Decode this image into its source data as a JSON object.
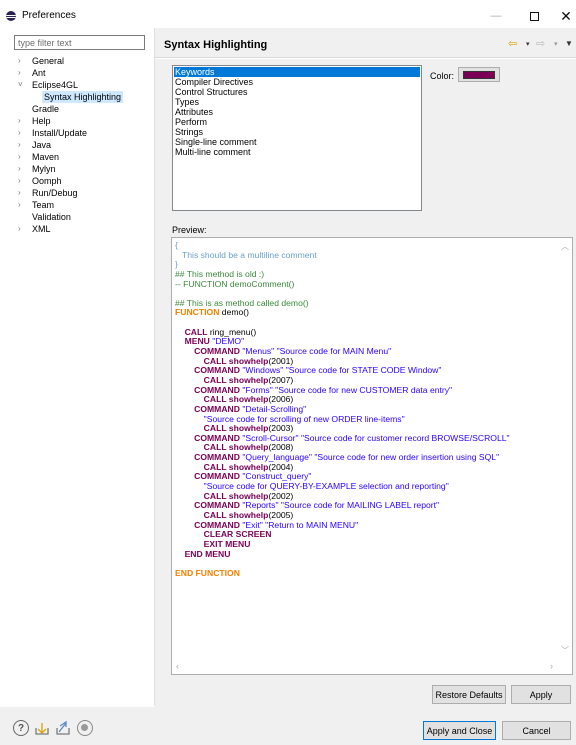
{
  "window": {
    "title": "Preferences",
    "min": "—",
    "close": "✕"
  },
  "filter": {
    "placeholder": "type filter text",
    "value": ""
  },
  "tree": {
    "items": [
      {
        "label": "General",
        "arrow": "›"
      },
      {
        "label": "Ant",
        "arrow": "›"
      },
      {
        "label": "Eclipse4GL",
        "arrow": "˅"
      },
      {
        "label": "Syntax Highlighting",
        "arrow": "",
        "selected": true
      },
      {
        "label": "Gradle",
        "arrow": ""
      },
      {
        "label": "Help",
        "arrow": "›"
      },
      {
        "label": "Install/Update",
        "arrow": "›"
      },
      {
        "label": "Java",
        "arrow": "›"
      },
      {
        "label": "Maven",
        "arrow": "›"
      },
      {
        "label": "Mylyn",
        "arrow": "›"
      },
      {
        "label": "Oomph",
        "arrow": "›"
      },
      {
        "label": "Run/Debug",
        "arrow": "›"
      },
      {
        "label": "Team",
        "arrow": "›"
      },
      {
        "label": "Validation",
        "arrow": ""
      },
      {
        "label": "XML",
        "arrow": "›"
      }
    ]
  },
  "page": {
    "title": "Syntax Highlighting",
    "nav": {
      "back": "⇦",
      "forward": "⇨",
      "dropdown": "▾",
      "menu": "▼"
    }
  },
  "elements": {
    "items": [
      "Keywords",
      "Compiler Directives",
      "Control Structures",
      "Types",
      "Attributes",
      "Perform",
      "Strings",
      "Single-line comment",
      "Multi-line comment"
    ],
    "selected_index": 0,
    "color_label": "Color:",
    "color_value": "#7a0055"
  },
  "preview": {
    "label": "Preview:",
    "colors": {
      "multiline_comment": "#6aa0c8",
      "singleline_comment": "#3a8a3a",
      "function_kw": "#f08000",
      "keyword": "#7a0055",
      "string": "#2a00ff"
    },
    "lines": [
      [
        [
          "mc",
          "{"
        ]
      ],
      [
        [
          "mc",
          "   This should be a multiline comment"
        ]
      ],
      [
        [
          "mc",
          "}"
        ]
      ],
      [
        [
          "sc",
          "## This method is old :)"
        ]
      ],
      [
        [
          "sc",
          "-- FUNCTION demoComment()"
        ]
      ],
      [],
      [
        [
          "sc",
          "## This is as method called demo()"
        ]
      ],
      [
        [
          "fn",
          "FUNCTION"
        ],
        [
          "pl",
          " demo()"
        ]
      ],
      [],
      [
        [
          "pl",
          "    "
        ],
        [
          "kw",
          "CALL"
        ],
        [
          "pl",
          " ring_menu()"
        ]
      ],
      [
        [
          "pl",
          "    "
        ],
        [
          "kw",
          "MENU"
        ],
        [
          "pl",
          " "
        ],
        [
          "str",
          "\"DEMO\""
        ]
      ],
      [
        [
          "pl",
          "        "
        ],
        [
          "kw",
          "COMMAND"
        ],
        [
          "pl",
          " "
        ],
        [
          "str",
          "\"Menus\""
        ],
        [
          "pl",
          " "
        ],
        [
          "str",
          "\"Source code for MAIN Menu\""
        ]
      ],
      [
        [
          "pl",
          "            "
        ],
        [
          "kw",
          "CALL showhelp"
        ],
        [
          "pl",
          "(2001)"
        ]
      ],
      [
        [
          "pl",
          "        "
        ],
        [
          "kw",
          "COMMAND"
        ],
        [
          "pl",
          " "
        ],
        [
          "str",
          "\"Windows\""
        ],
        [
          "pl",
          " "
        ],
        [
          "str",
          "\"Source code for STATE CODE Window\""
        ]
      ],
      [
        [
          "pl",
          "            "
        ],
        [
          "kw",
          "CALL showhelp"
        ],
        [
          "pl",
          "(2007)"
        ]
      ],
      [
        [
          "pl",
          "        "
        ],
        [
          "kw",
          "COMMAND"
        ],
        [
          "pl",
          " "
        ],
        [
          "str",
          "\"Forms\""
        ],
        [
          "pl",
          " "
        ],
        [
          "str",
          "\"Source code for new CUSTOMER data entry\""
        ]
      ],
      [
        [
          "pl",
          "            "
        ],
        [
          "kw",
          "CALL showhelp"
        ],
        [
          "pl",
          "(2006)"
        ]
      ],
      [
        [
          "pl",
          "        "
        ],
        [
          "kw",
          "COMMAND"
        ],
        [
          "pl",
          " "
        ],
        [
          "str",
          "\"Detail-Scrolling\""
        ]
      ],
      [
        [
          "pl",
          "            "
        ],
        [
          "str",
          "\"Source code for scrolling of new ORDER line-items\""
        ]
      ],
      [
        [
          "pl",
          "            "
        ],
        [
          "kw",
          "CALL showhelp"
        ],
        [
          "pl",
          "(2003)"
        ]
      ],
      [
        [
          "pl",
          "        "
        ],
        [
          "kw",
          "COMMAND"
        ],
        [
          "pl",
          " "
        ],
        [
          "str",
          "\"Scroll-Cursor\""
        ],
        [
          "pl",
          " "
        ],
        [
          "str",
          "\"Source code for customer record BROWSE/SCROLL\""
        ]
      ],
      [
        [
          "pl",
          "            "
        ],
        [
          "kw",
          "CALL showhelp"
        ],
        [
          "pl",
          "(2008)"
        ]
      ],
      [
        [
          "pl",
          "        "
        ],
        [
          "kw",
          "COMMAND"
        ],
        [
          "pl",
          " "
        ],
        [
          "str",
          "\"Query_language\""
        ],
        [
          "pl",
          " "
        ],
        [
          "str",
          "\"Source code for new order insertion using SQL\""
        ]
      ],
      [
        [
          "pl",
          "            "
        ],
        [
          "kw",
          "CALL showhelp"
        ],
        [
          "pl",
          "(2004)"
        ]
      ],
      [
        [
          "pl",
          "        "
        ],
        [
          "kw",
          "COMMAND"
        ],
        [
          "pl",
          " "
        ],
        [
          "str",
          "\"Construct_query\""
        ]
      ],
      [
        [
          "pl",
          "            "
        ],
        [
          "str",
          "\"Source code for QUERY-BY-EXAMPLE selection and reporting\""
        ]
      ],
      [
        [
          "pl",
          "            "
        ],
        [
          "kw",
          "CALL showhelp"
        ],
        [
          "pl",
          "(2002)"
        ]
      ],
      [
        [
          "pl",
          "        "
        ],
        [
          "kw",
          "COMMAND"
        ],
        [
          "pl",
          " "
        ],
        [
          "str",
          "\"Reports\""
        ],
        [
          "pl",
          " "
        ],
        [
          "str",
          "\"Source code for MAILING LABEL report\""
        ]
      ],
      [
        [
          "pl",
          "            "
        ],
        [
          "kw",
          "CALL showhelp"
        ],
        [
          "pl",
          "(2005)"
        ]
      ],
      [
        [
          "pl",
          "        "
        ],
        [
          "kw",
          "COMMAND"
        ],
        [
          "pl",
          " "
        ],
        [
          "str",
          "\"Exit\""
        ],
        [
          "pl",
          " "
        ],
        [
          "str",
          "\"Return to MAIN MENU\""
        ]
      ],
      [
        [
          "pl",
          "            "
        ],
        [
          "kw",
          "CLEAR SCREEN"
        ]
      ],
      [
        [
          "pl",
          "            "
        ],
        [
          "kw",
          "EXIT MENU"
        ]
      ],
      [
        [
          "pl",
          "    "
        ],
        [
          "kw",
          "END MENU"
        ]
      ],
      [],
      [
        [
          "fn",
          "END FUNCTION"
        ]
      ]
    ]
  },
  "buttons": {
    "restore_defaults": "Restore Defaults",
    "apply": "Apply",
    "apply_and_close": "Apply and Close",
    "cancel": "Cancel"
  },
  "bottom_icons": [
    "help-icon",
    "import-icon",
    "export-icon",
    "record-icon"
  ]
}
